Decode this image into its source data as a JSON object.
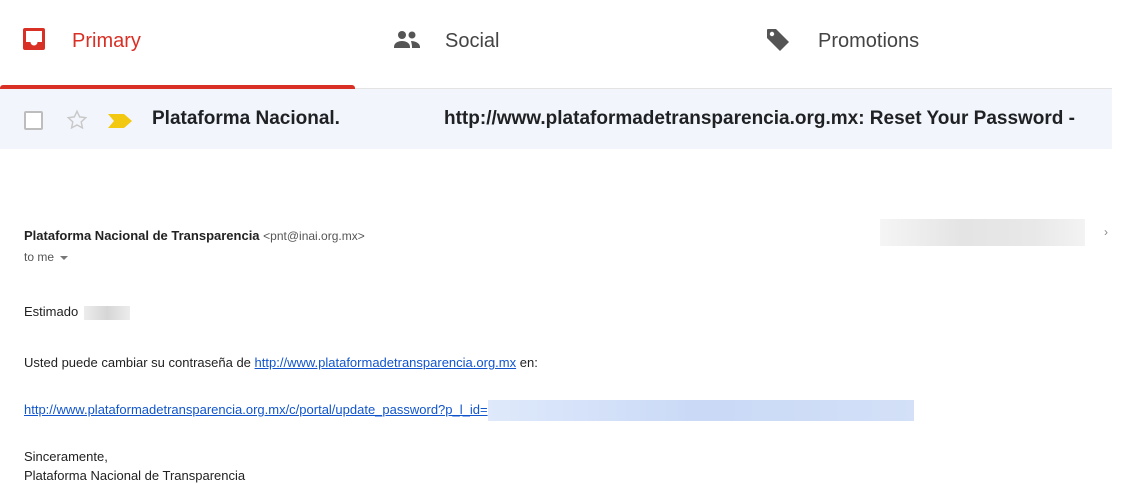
{
  "tabs": {
    "primary": {
      "label": "Primary",
      "icon": "inbox-icon",
      "color": "#d93025"
    },
    "social": {
      "label": "Social",
      "icon": "people-icon"
    },
    "promotions": {
      "label": "Promotions",
      "icon": "tag-icon"
    }
  },
  "row": {
    "sender": "Plataforma Nacional.",
    "subject": "http://www.plataformadetransparencia.org.mx: Reset Your Password -"
  },
  "email": {
    "from_name": "Plataforma Nacional de Transparencia",
    "from_email": "<pnt@inai.org.mx>",
    "to": "to me",
    "greeting": "Estimado",
    "line1_prefix": "Usted puede cambiar su contraseña de",
    "line1_link": "http://www.plataformadetransparencia.org.mx",
    "line1_suffix": "en:",
    "reset_link": "http://www.plataformadetransparencia.org.mx/c/portal/update_password?p_l_id=",
    "closing": "Sinceramente,",
    "signature": "Plataforma Nacional de Transparencia"
  },
  "colors": {
    "link": "#1155cc",
    "row_bg": "#f2f6fc",
    "important": "#f2c811"
  }
}
